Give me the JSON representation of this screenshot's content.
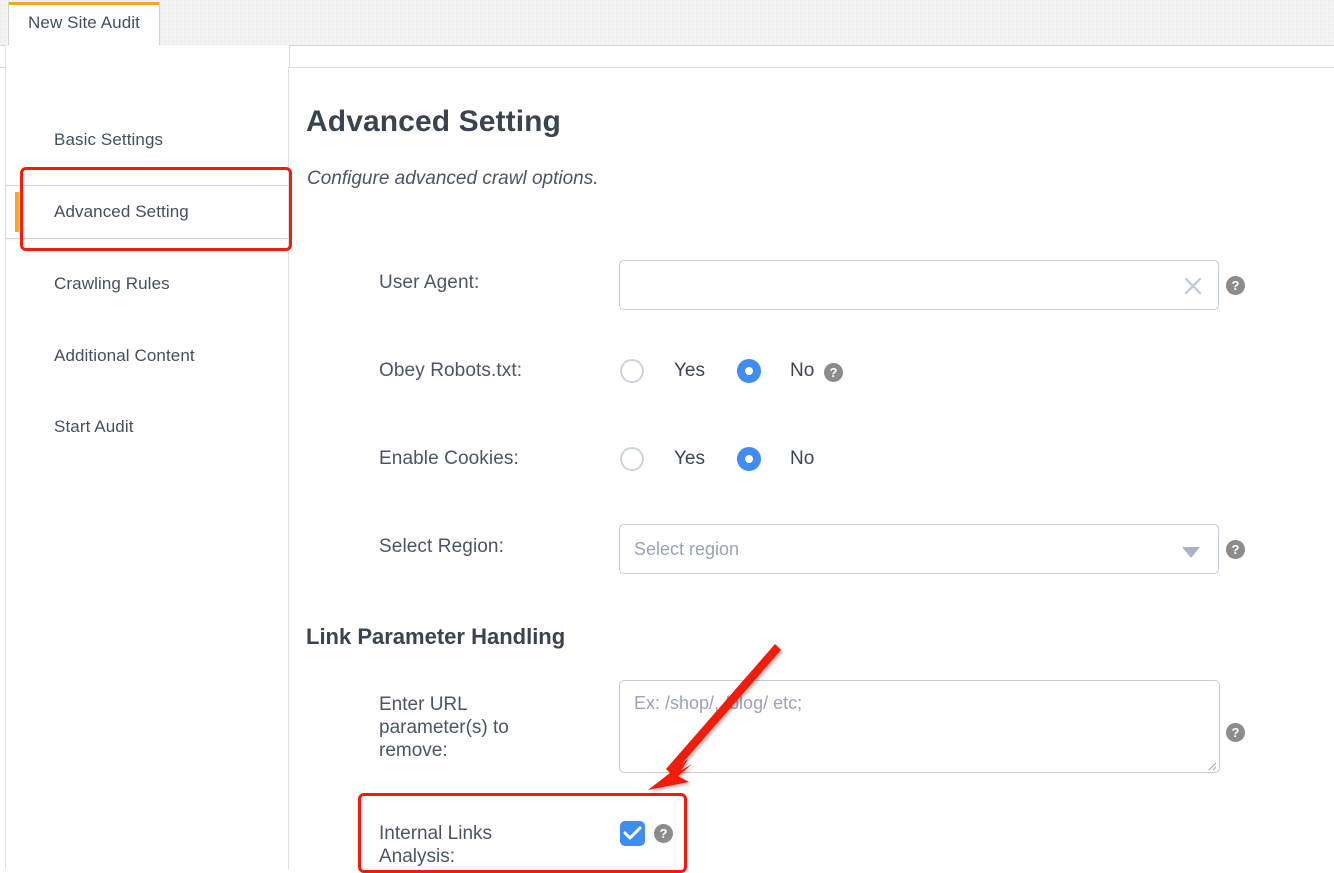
{
  "window": {
    "tab_label": "New Site Audit"
  },
  "sidebar": {
    "items": [
      {
        "label": "Basic Settings",
        "active": false
      },
      {
        "label": "Advanced Setting",
        "active": true
      },
      {
        "label": "Crawling Rules",
        "active": false
      },
      {
        "label": "Additional Content",
        "active": false
      },
      {
        "label": "Start Audit",
        "active": false
      }
    ]
  },
  "main": {
    "title": "Advanced Setting",
    "subtitle": "Configure advanced crawl options.",
    "fields": {
      "user_agent": {
        "label": "User Agent:",
        "value": "",
        "placeholder": "",
        "clear_icon": "close-x-icon",
        "help_icon": "question-mark-icon"
      },
      "obey_robots": {
        "label": "Obey Robots.txt:",
        "option_yes": "Yes",
        "option_no": "No",
        "selected": "No",
        "help_icon": "question-mark-icon"
      },
      "enable_cookies": {
        "label": "Enable Cookies:",
        "option_yes": "Yes",
        "option_no": "No",
        "selected": "No"
      },
      "select_region": {
        "label": "Select Region:",
        "value": "",
        "placeholder": "Select region",
        "chevron_icon": "chevron-down-icon",
        "help_icon": "question-mark-icon"
      }
    },
    "link_parameter_handling": {
      "heading": "Link Parameter Handling",
      "url_params": {
        "label": "Enter URL parameter(s) to remove:",
        "value": "",
        "placeholder": "Ex: /shop/, /blog/ etc;",
        "help_icon": "question-mark-icon"
      },
      "internal_links": {
        "label": "Internal Links Analysis:",
        "checked": true,
        "help_icon": "question-mark-icon"
      }
    }
  },
  "annotations": {
    "highlight_color": "#f21b0d",
    "accent_color": "#f5a623",
    "radio_selected_color": "#3f8cf4",
    "boxes": [
      {
        "name": "sidebar-advanced-setting-highlight"
      },
      {
        "name": "internal-links-analysis-highlight"
      }
    ],
    "arrow": {
      "name": "pointer-arrow",
      "from": "top-right",
      "to": "bottom-left"
    }
  }
}
